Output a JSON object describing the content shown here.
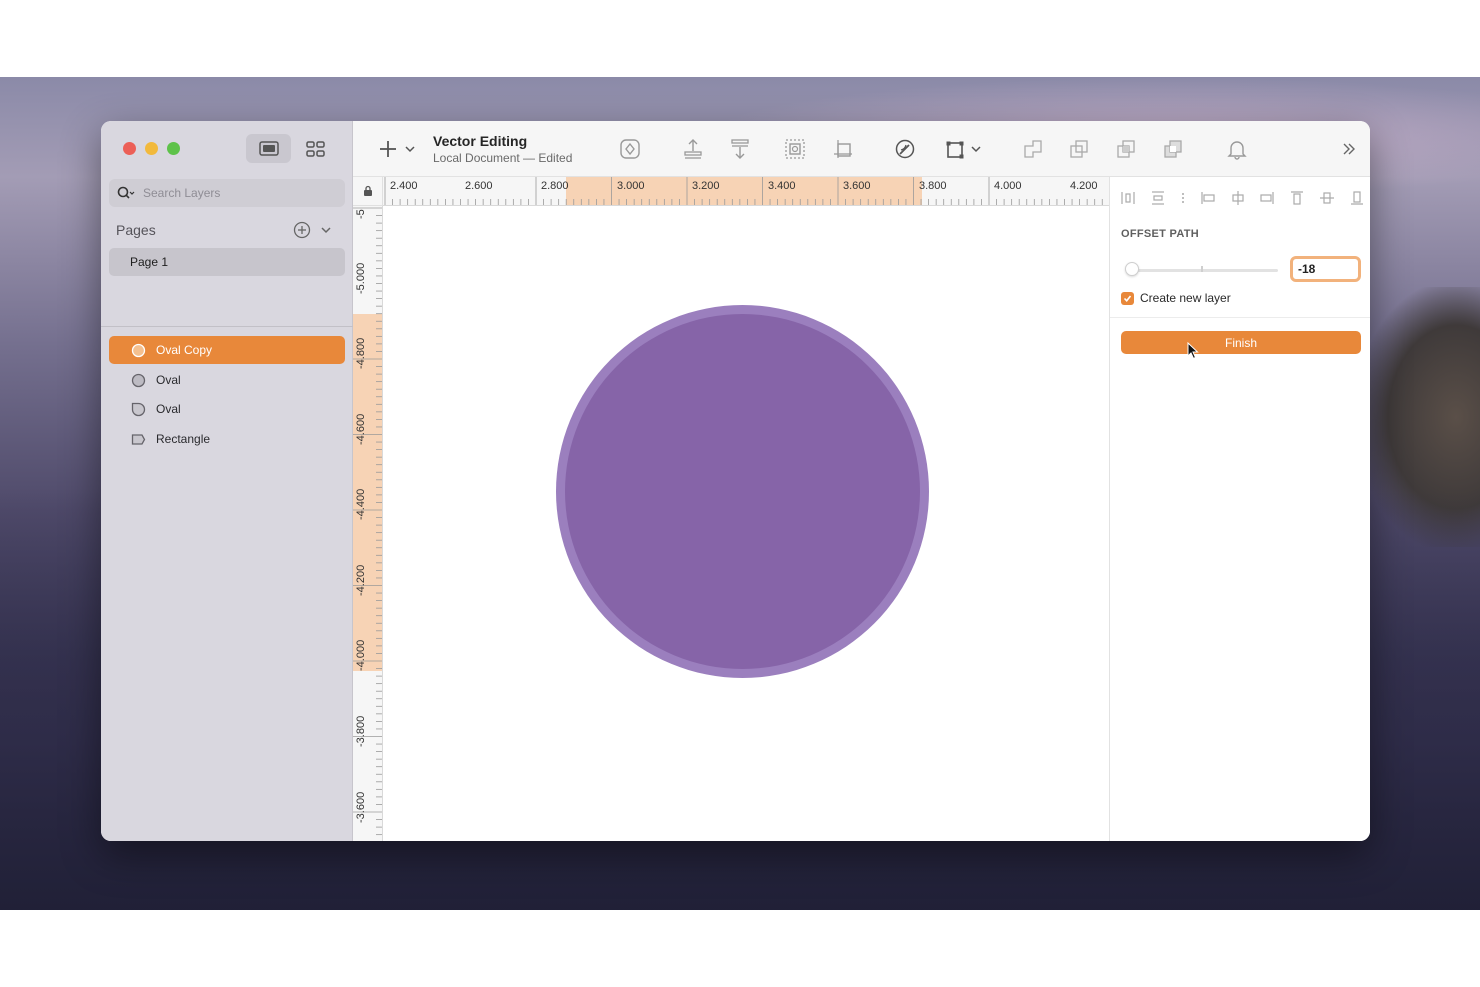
{
  "window": {
    "title": "Vector Editing",
    "subtitle": "Local Document — Edited"
  },
  "sidebar": {
    "search_placeholder": "Search Layers",
    "pages_label": "Pages",
    "pages": [
      {
        "label": "Page 1"
      }
    ],
    "layers": [
      {
        "label": "Oval Copy",
        "icon": "oval-icon",
        "selected": true
      },
      {
        "label": "Oval",
        "icon": "oval-icon",
        "selected": false
      },
      {
        "label": "Oval",
        "icon": "oval-outline-icon",
        "selected": false
      },
      {
        "label": "Rectangle",
        "icon": "rectangle-icon",
        "selected": false
      }
    ]
  },
  "toolbar": {
    "icons": [
      "add-icon",
      "create-symbol-icon",
      "insert-icon",
      "tools-icon",
      "mask-icon",
      "scale-icon",
      "edit-icon",
      "transform-icon",
      "union-icon",
      "subtract-icon",
      "intersect-icon",
      "difference-icon",
      "notifications-icon",
      "more-icon"
    ]
  },
  "rulers": {
    "horizontal": [
      "2.400",
      "2.600",
      "2.800",
      "3.000",
      "3.200",
      "3.400",
      "3.600",
      "3.800",
      "4.000",
      "4.200"
    ],
    "vertical": [
      "-5",
      "-5.000",
      "-4.800",
      "-4.600",
      "-4.400",
      "-4.200",
      "-4.000",
      "-3.800",
      "-3.600"
    ]
  },
  "inspector": {
    "section_title": "OFFSET PATH",
    "offset_value": "-18",
    "checkbox_label": "Create new layer",
    "checkbox_checked": true,
    "finish_label": "Finish"
  },
  "colors": {
    "accent": "#e8883a",
    "shape_fill": "#8664a8",
    "shape_border": "#9b7fbe"
  }
}
